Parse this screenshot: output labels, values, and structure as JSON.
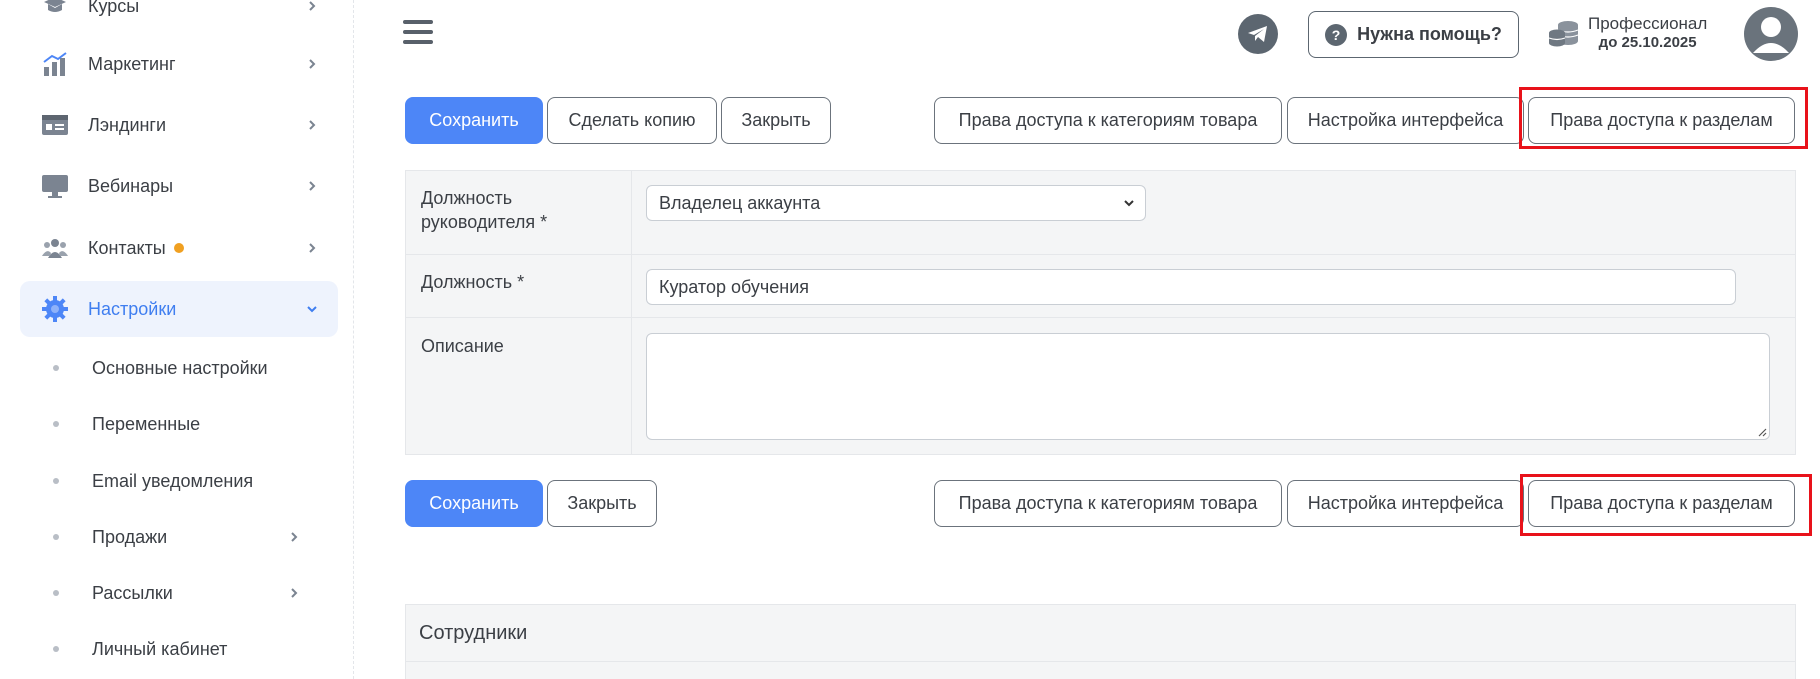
{
  "sidebar": {
    "items": [
      {
        "label": "Курсы",
        "icon": "graduation-cap-icon"
      },
      {
        "label": "Маркетинг",
        "icon": "chart-bars-icon"
      },
      {
        "label": "Лэндинги",
        "icon": "browser-window-icon"
      },
      {
        "label": "Вебинары",
        "icon": "monitor-icon"
      },
      {
        "label": "Контакты",
        "icon": "users-icon",
        "badge_color": "#f0a021"
      },
      {
        "label": "Настройки",
        "icon": "gear-icon",
        "active": true
      }
    ],
    "subitems": [
      {
        "label": "Основные настройки"
      },
      {
        "label": "Переменные"
      },
      {
        "label": "Email уведомления"
      },
      {
        "label": "Продажи"
      },
      {
        "label": "Рассылки"
      },
      {
        "label": "Личный кабинет"
      }
    ]
  },
  "header": {
    "help_label": "Нужна помощь?",
    "help_icon": "question-circle-icon",
    "telegram_icon": "telegram-icon",
    "plan_name": "Профессионал",
    "plan_date": "до 25.10.2025",
    "plan_icon": "coins-icon",
    "avatar_icon": "user-avatar-icon"
  },
  "toolbar_top": {
    "save": "Сохранить",
    "copy": "Сделать копию",
    "close": "Закрыть",
    "product_access": "Права доступа к категориям товара",
    "interface_settings": "Настройка интерфейса",
    "section_access": "Права доступа к разделам"
  },
  "toolbar_bottom": {
    "save": "Сохранить",
    "close": "Закрыть",
    "product_access": "Права доступа к категориям товара",
    "interface_settings": "Настройка интерфейса",
    "section_access": "Права доступа к разделам"
  },
  "form": {
    "manager_position_label_line1": "Должность",
    "manager_position_label_line2": "руководителя *",
    "manager_position_value": "Владелец аккаунта",
    "position_label": "Должность *",
    "position_value": "Куратор обучения",
    "description_label": "Описание",
    "description_value": ""
  },
  "employees": {
    "title": "Сотрудники"
  },
  "colors": {
    "primary": "#4d86f7",
    "highlight": "#e8121a",
    "active_nav_bg": "#eef3fd",
    "active_nav_text": "#3f7ef0"
  }
}
